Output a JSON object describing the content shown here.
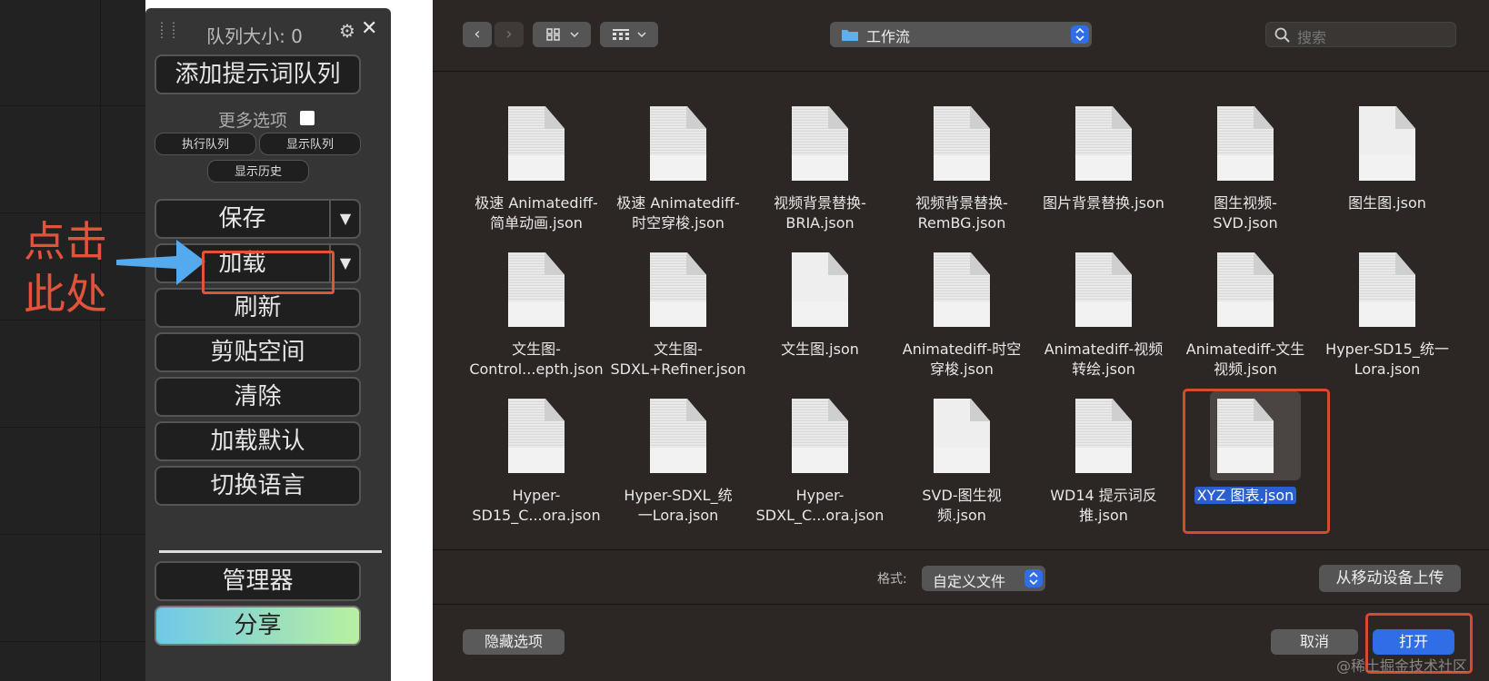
{
  "comfy_panel": {
    "queue_size": "队列大小: 0",
    "add_prompt_queue": "添加提示词队列",
    "more_options": "更多选项",
    "execute_queue": "执行队列",
    "show_queue": "显示队列",
    "show_history": "显示历史",
    "save": "保存",
    "load": "加载",
    "refresh": "刷新",
    "clipspace": "剪贴空间",
    "clear": "清除",
    "load_default": "加载默认",
    "switch_language": "切换语言",
    "manager": "管理器",
    "share": "分享",
    "dropdown_glyph": "▼"
  },
  "annotation": {
    "line1": "点击",
    "line2": "此处",
    "color": "#e1533a"
  },
  "dialog": {
    "folder_name": "工作流",
    "search_placeholder": "搜索",
    "files": [
      {
        "line1": "极速 Animatediff-",
        "line2": "简单动画.json"
      },
      {
        "line1": "极速 Animatediff-",
        "line2": "时空穿梭.json"
      },
      {
        "line1": "视频背景替换-",
        "line2": "BRIA.json"
      },
      {
        "line1": "视频背景替换-",
        "line2": "RemBG.json"
      },
      {
        "line1": "图片背景替换.json",
        "line2": ""
      },
      {
        "line1": "图生视频-",
        "line2": "SVD.json"
      },
      {
        "line1": "图生图.json",
        "line2": ""
      },
      {
        "line1": "文生图-",
        "line2": "Control...epth.json"
      },
      {
        "line1": "文生图-",
        "line2": "SDXL+Refiner.json"
      },
      {
        "line1": "文生图.json",
        "line2": ""
      },
      {
        "line1": "Animatediff-时空",
        "line2": "穿梭.json"
      },
      {
        "line1": "Animatediff-视频",
        "line2": "转绘.json"
      },
      {
        "line1": "Animatediff-文生",
        "line2": "视频.json"
      },
      {
        "line1": "Hyper-SD15_统一",
        "line2": "Lora.json"
      },
      {
        "line1": "Hyper-",
        "line2": "SD15_C...ora.json"
      },
      {
        "line1": "Hyper-SDXL_统",
        "line2": "一Lora.json"
      },
      {
        "line1": "Hyper-",
        "line2": "SDXL_C...ora.json"
      },
      {
        "line1": "SVD-图生视",
        "line2": "频.json"
      },
      {
        "line1": "WD14 提示词反",
        "line2": "推.json"
      },
      {
        "line1": "XYZ 图表.json",
        "line2": ""
      }
    ],
    "selected_index": 19,
    "format_label": "格式:",
    "format_value": "自定义文件",
    "upload_mobile": "从移动设备上传",
    "hide_options": "隐藏选项",
    "cancel": "取消",
    "open": "打开",
    "selection_color": "#2b5fcf",
    "highlight_color": "#d84a2f"
  },
  "watermark": "@稀土掘金技术社区"
}
